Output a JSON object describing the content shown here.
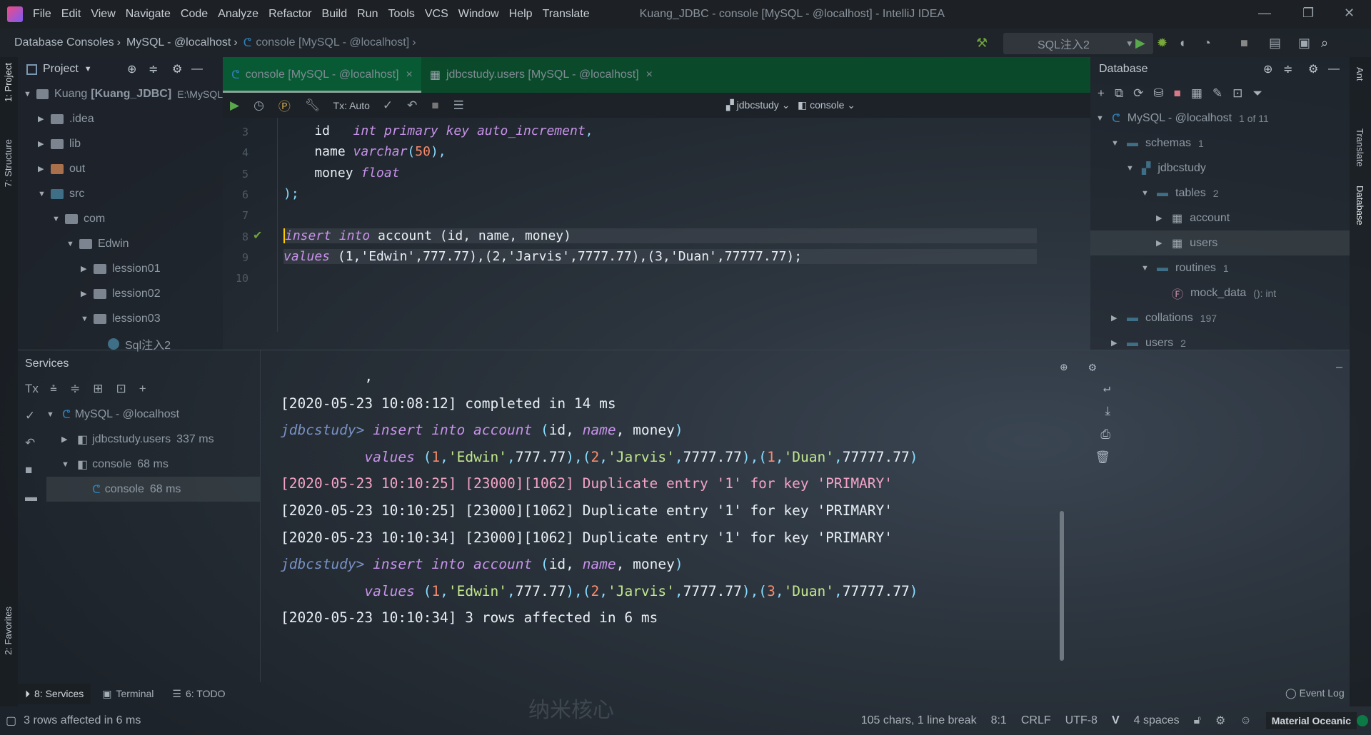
{
  "window": {
    "title": "Kuang_JDBC - console [MySQL - @localhost] - IntelliJ IDEA",
    "minimize": "—",
    "restore": "❐",
    "close": "✕"
  },
  "menu": [
    "File",
    "Edit",
    "View",
    "Navigate",
    "Code",
    "Analyze",
    "Refactor",
    "Build",
    "Run",
    "Tools",
    "VCS",
    "Window",
    "Help",
    "Translate"
  ],
  "breadcrumb": [
    "Database Consoles",
    "MySQL - @localhost",
    "console [MySQL - @localhost]"
  ],
  "toolbar": {
    "run_config": "SQL注入2"
  },
  "left_stripe": {
    "project": "1: Project",
    "structure": "7: Structure",
    "favorites": "2: Favorites"
  },
  "right_stripe": {
    "ant": "Ant",
    "translate": "Translate",
    "database": "Database"
  },
  "project": {
    "title": "Project",
    "tree": [
      {
        "label": "Kuang",
        "bold": "[Kuang_JDBC]",
        "path": "E:\\MySQL",
        "depth": 0,
        "open": true,
        "color": "#7c858f"
      },
      {
        "label": ".idea",
        "depth": 1,
        "open": false,
        "color": "#7c858f"
      },
      {
        "label": "lib",
        "depth": 1,
        "open": false,
        "color": "#7c858f"
      },
      {
        "label": "out",
        "depth": 1,
        "open": false,
        "color": "#a8714c"
      },
      {
        "label": "src",
        "depth": 1,
        "open": true,
        "color": "#3e6f86"
      },
      {
        "label": "com",
        "depth": 2,
        "open": true,
        "color": "#7c858f"
      },
      {
        "label": "Edwin",
        "depth": 3,
        "open": true,
        "color": "#7c858f"
      },
      {
        "label": "lession01",
        "depth": 4,
        "open": false,
        "color": "#7c858f"
      },
      {
        "label": "lession02",
        "depth": 4,
        "open": false,
        "color": "#7c858f"
      },
      {
        "label": "lession03",
        "depth": 4,
        "open": true,
        "color": "#7c858f"
      },
      {
        "label": "Sql注入2",
        "depth": 5,
        "leaf": true,
        "color": "#3e6f86"
      }
    ]
  },
  "editor": {
    "tabs": [
      {
        "label": "console [MySQL - @localhost]",
        "active": true
      },
      {
        "label": "jdbcstudy.users [MySQL - @localhost]",
        "active": false
      }
    ],
    "tx": "Tx: Auto",
    "schema": "jdbcstudy",
    "session": "console",
    "lines": [
      {
        "n": "3",
        "tokens": [
          [
            "pl",
            "    id   "
          ],
          [
            "kw",
            "int primary key auto_increment"
          ],
          [
            "pun",
            ","
          ]
        ]
      },
      {
        "n": "4",
        "tokens": [
          [
            "pl",
            "    name "
          ],
          [
            "kw",
            "varchar"
          ],
          [
            "pun",
            "("
          ],
          [
            "num",
            "50"
          ],
          [
            "pun",
            "),"
          ]
        ]
      },
      {
        "n": "5",
        "tokens": [
          [
            "pl",
            "    money "
          ],
          [
            "kw",
            "float"
          ]
        ]
      },
      {
        "n": "6",
        "tokens": [
          [
            "pun",
            ");"
          ]
        ]
      },
      {
        "n": "7",
        "tokens": []
      },
      {
        "n": "8",
        "current": true,
        "tokens": [
          [
            "kw",
            "insert into"
          ],
          [
            "pl",
            " account (id, name, money)"
          ]
        ]
      },
      {
        "n": "9",
        "hl": true,
        "tokens": [
          [
            "kw",
            "values"
          ],
          [
            "pl",
            " (1,'Edwin',777.77),(2,'Jarvis',7777.77),(3,'Duan',77777.77);"
          ]
        ]
      },
      {
        "n": "10",
        "tokens": []
      }
    ]
  },
  "database": {
    "title": "Database",
    "tree": [
      {
        "label": "MySQL - @localhost",
        "count": "1 of 11",
        "depth": 0,
        "open": true,
        "type": "mysql"
      },
      {
        "label": "schemas",
        "count": "1",
        "depth": 1,
        "open": true,
        "type": "folder"
      },
      {
        "label": "jdbcstudy",
        "count": "",
        "depth": 2,
        "open": true,
        "type": "schema"
      },
      {
        "label": "tables",
        "count": "2",
        "depth": 3,
        "open": true,
        "type": "folder"
      },
      {
        "label": "account",
        "count": "",
        "depth": 4,
        "open": false,
        "type": "table"
      },
      {
        "label": "users",
        "count": "",
        "depth": 4,
        "open": false,
        "type": "table",
        "selected": true
      },
      {
        "label": "routines",
        "count": "1",
        "depth": 3,
        "open": true,
        "type": "folder"
      },
      {
        "label": "mock_data",
        "count": "(): int",
        "depth": 4,
        "leaf": true,
        "type": "function"
      },
      {
        "label": "collations",
        "count": "197",
        "depth": 1,
        "open": false,
        "type": "folder"
      },
      {
        "label": "users",
        "count": "2",
        "depth": 1,
        "open": false,
        "type": "folder"
      }
    ]
  },
  "services": {
    "title": "Services",
    "tx": "Tx",
    "tree": [
      {
        "label": "MySQL - @localhost",
        "time": "",
        "depth": 0,
        "open": true
      },
      {
        "label": "jdbcstudy.users",
        "time": "337 ms",
        "depth": 1,
        "open": false
      },
      {
        "label": "console",
        "time": "68 ms",
        "depth": 1,
        "open": true
      },
      {
        "label": "console",
        "time": "68 ms",
        "depth": 2,
        "leaf": true,
        "selected": true
      }
    ],
    "console": [
      {
        "cls": "pl",
        "tokens": [
          [
            "pl",
            "          ,"
          ]
        ]
      },
      {
        "tokens": [
          [
            "pl",
            "[2020-05-23 10:08:12] completed in 14 ms"
          ]
        ]
      },
      {
        "tokens": [
          [
            "prompt",
            "jdbcstudy> "
          ],
          [
            "kw",
            "insert into account"
          ],
          [
            "pun",
            " ("
          ],
          [
            "pl",
            "id, "
          ],
          [
            "kw",
            "name"
          ],
          [
            "pl",
            ", money"
          ],
          [
            "pun",
            ")"
          ]
        ]
      },
      {
        "tokens": [
          [
            "pl",
            "          "
          ],
          [
            "kw",
            "values"
          ],
          [
            "pun",
            " ("
          ],
          [
            "num",
            "1"
          ],
          [
            "pun",
            ","
          ],
          [
            "str",
            "'Edwin'"
          ],
          [
            "pun",
            ","
          ],
          [
            "pl",
            "777.77"
          ],
          [
            "pun",
            "),("
          ],
          [
            "num",
            "2"
          ],
          [
            "pun",
            ","
          ],
          [
            "str",
            "'Jarvis'"
          ],
          [
            "pun",
            ","
          ],
          [
            "pl",
            "7777.77"
          ],
          [
            "pun",
            "),("
          ],
          [
            "num",
            "1"
          ],
          [
            "pun",
            ","
          ],
          [
            "str",
            "'Duan'"
          ],
          [
            "pun",
            ","
          ],
          [
            "pl",
            "77777.77"
          ],
          [
            "pun",
            ")"
          ]
        ]
      },
      {
        "tokens": [
          [
            "err",
            "[2020-05-23 10:10:25] [23000][1062] Duplicate entry '1' for key 'PRIMARY'"
          ]
        ]
      },
      {
        "tokens": [
          [
            "pl",
            "[2020-05-23 10:10:25] [23000][1062] Duplicate entry '1' for key 'PRIMARY'"
          ]
        ]
      },
      {
        "tokens": [
          [
            "pl",
            "[2020-05-23 10:10:34] [23000][1062] Duplicate entry '1' for key 'PRIMARY'"
          ]
        ]
      },
      {
        "tokens": [
          [
            "prompt",
            "jdbcstudy> "
          ],
          [
            "kw",
            "insert into account"
          ],
          [
            "pun",
            " ("
          ],
          [
            "pl",
            "id, "
          ],
          [
            "kw",
            "name"
          ],
          [
            "pl",
            ", money"
          ],
          [
            "pun",
            ")"
          ]
        ]
      },
      {
        "tokens": [
          [
            "pl",
            "          "
          ],
          [
            "kw",
            "values"
          ],
          [
            "pun",
            " ("
          ],
          [
            "num",
            "1"
          ],
          [
            "pun",
            ","
          ],
          [
            "str",
            "'Edwin'"
          ],
          [
            "pun",
            ","
          ],
          [
            "pl",
            "777.77"
          ],
          [
            "pun",
            "),("
          ],
          [
            "num",
            "2"
          ],
          [
            "pun",
            ","
          ],
          [
            "str",
            "'Jarvis'"
          ],
          [
            "pun",
            ","
          ],
          [
            "pl",
            "7777.77"
          ],
          [
            "pun",
            "),("
          ],
          [
            "num",
            "3"
          ],
          [
            "pun",
            ","
          ],
          [
            "str",
            "'Duan'"
          ],
          [
            "pun",
            ","
          ],
          [
            "pl",
            "77777.77"
          ],
          [
            "pun",
            ")"
          ]
        ]
      },
      {
        "tokens": [
          [
            "pl",
            "[2020-05-23 10:10:34] 3 rows affected in 6 ms"
          ]
        ]
      }
    ]
  },
  "bottom_tabs": [
    {
      "label": "8: Services",
      "active": true
    },
    {
      "label": "Terminal"
    },
    {
      "label": "6: TODO"
    }
  ],
  "event_log": "Event Log",
  "watermark": "纳米核心",
  "status": {
    "message": "3 rows affected in 6 ms",
    "chars": "105 chars, 1 line break",
    "position": "8:1",
    "line_sep": "CRLF",
    "encoding": "UTF-8",
    "indent": "4 spaces",
    "theme": "Material Oceanic"
  }
}
